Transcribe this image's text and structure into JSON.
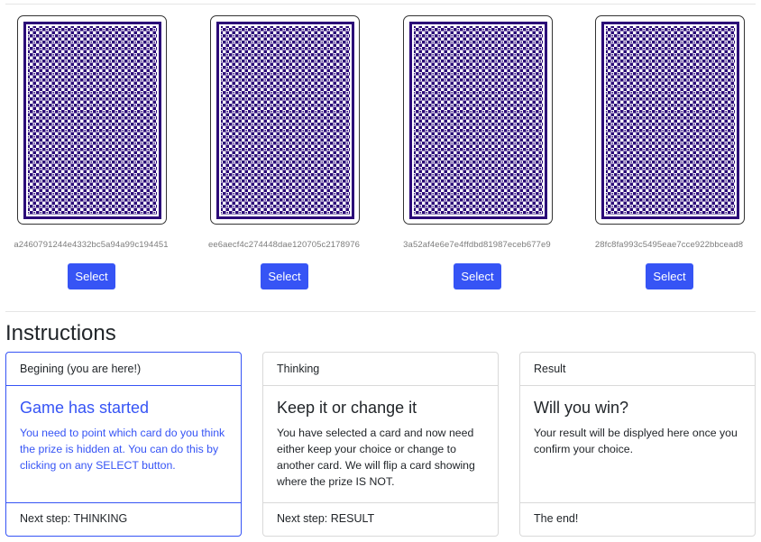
{
  "cards": [
    {
      "id": "a2460791244e4332bc5a94a99c194451",
      "select_label": "Select"
    },
    {
      "id": "ee6aecf4c274448dae120705c2178976",
      "select_label": "Select"
    },
    {
      "id": "3a52af4e6e7e4ffdbd81987eceb677e9",
      "select_label": "Select"
    },
    {
      "id": "28fc8fa993c5495eae7cce922bbcead8",
      "select_label": "Select"
    }
  ],
  "instructions": {
    "title": "Instructions",
    "steps": [
      {
        "header": "Begining (you are here!)",
        "title": "Game has started",
        "text": "You need to point which card do you think the prize is hidden at. You can do this by clicking on any SELECT button.",
        "footer": "Next step: THINKING"
      },
      {
        "header": "Thinking",
        "title": "Keep it or change it",
        "text": "You have selected a card and now need either keep your choice or change to another card. We will flip a card showing where the prize IS NOT.",
        "footer": "Next step: RESULT"
      },
      {
        "header": "Result",
        "title": "Will you win?",
        "text": "Your result will be displyed here once you confirm your choice.",
        "footer": "The end!"
      }
    ]
  },
  "colors": {
    "accent": "#3654f5",
    "card_back": "#2b0a78"
  },
  "icons": {
    "card_back": "card-back-pattern"
  }
}
